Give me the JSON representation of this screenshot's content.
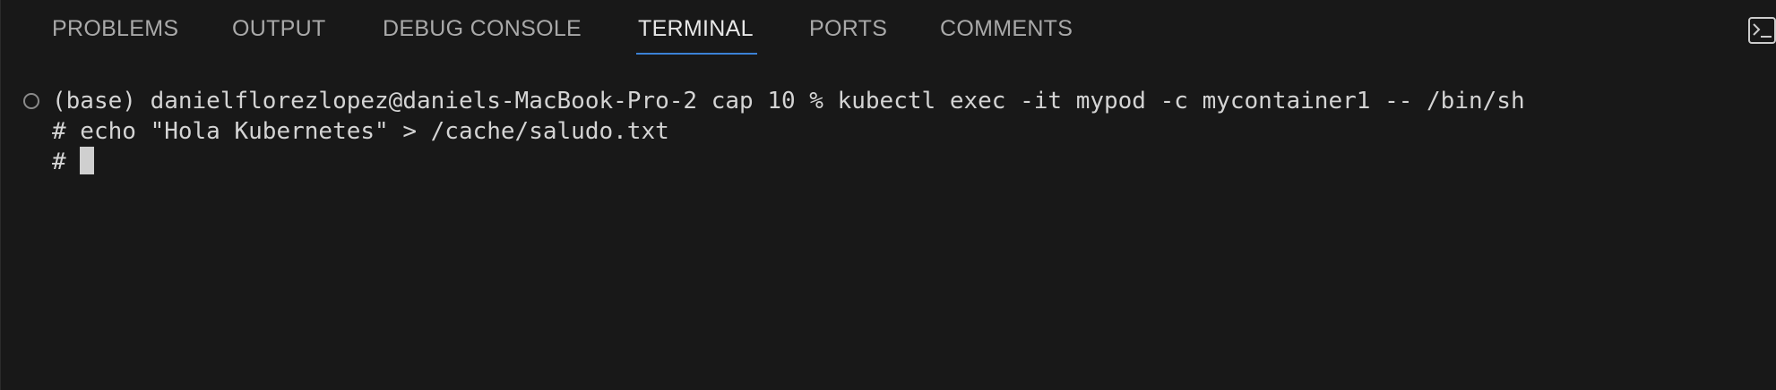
{
  "panel": {
    "tabs": [
      {
        "label": "PROBLEMS",
        "active": false
      },
      {
        "label": "OUTPUT",
        "active": false
      },
      {
        "label": "DEBUG CONSOLE",
        "active": false
      },
      {
        "label": "TERMINAL",
        "active": true
      },
      {
        "label": "PORTS",
        "active": false
      },
      {
        "label": "COMMENTS",
        "active": false
      }
    ],
    "actions": [
      {
        "icon": "terminal-icon"
      }
    ]
  },
  "terminal": {
    "lines": [
      "(base) danielflorezlopez@daniels-MacBook-Pro-2 cap 10 % kubectl exec -it mypod -c mycontainer1 -- /bin/sh",
      "# echo \"Hola Kubernetes\" > /cache/saludo.txt"
    ],
    "prompt": "# "
  },
  "colors": {
    "background": "#181818",
    "active_tab_underline": "#3b82d6",
    "text": "#d4d4d4",
    "inactive_tab": "#a9a9a9"
  }
}
